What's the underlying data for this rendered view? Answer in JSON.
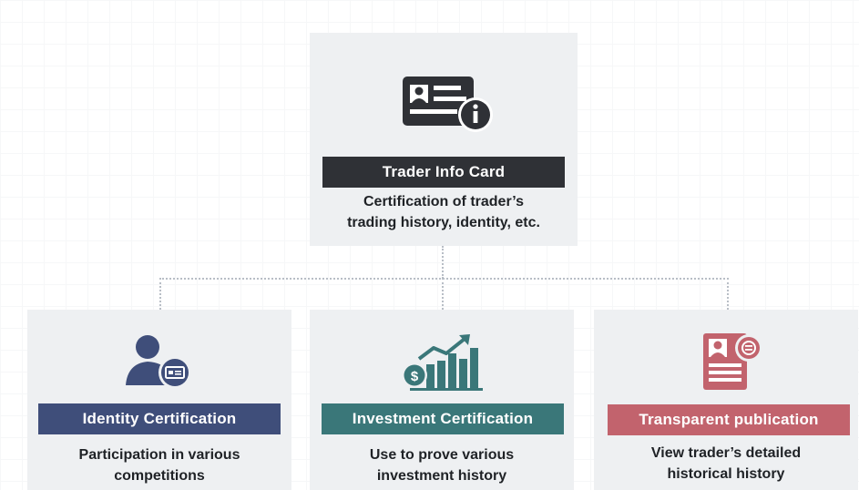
{
  "top": {
    "title": "Trader Info Card",
    "description": "Certification of trader’s\ntrading history, identity, etc.",
    "icon": "id-card-info-icon",
    "bar_color": "#2f3136"
  },
  "items": [
    {
      "title": "Identity Certification",
      "description": "Participation in various\ncompetitions",
      "icon": "user-id-card-icon",
      "bar_color": "#3f4e7a"
    },
    {
      "title": "Investment Certification",
      "description": "Use to prove various\ninvestment history",
      "icon": "investment-growth-chart-icon",
      "bar_color": "#3a7779"
    },
    {
      "title": "Transparent publication",
      "description": "View trader’s detailed\nhistorical history",
      "icon": "public-profile-document-icon",
      "bar_color": "#c2636d"
    }
  ]
}
